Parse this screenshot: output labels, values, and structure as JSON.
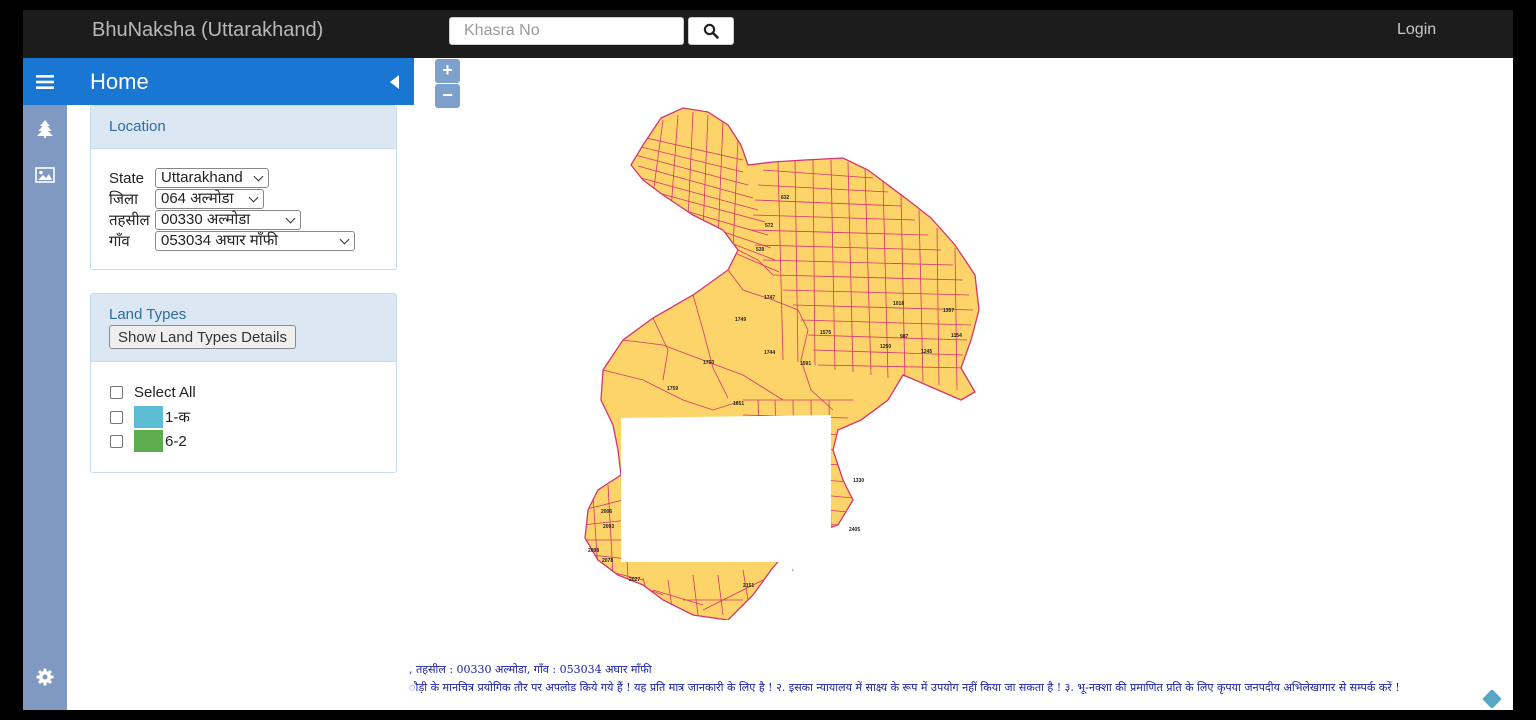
{
  "header": {
    "brand": "BhuNaksha (Uttarakhand)",
    "search_placeholder": "Khasra No",
    "login_label": "Login"
  },
  "panel": {
    "title": "Home"
  },
  "location": {
    "title": "Location",
    "fields": [
      {
        "label": "State",
        "value": "Uttarakhand"
      },
      {
        "label": "जिला",
        "value": "064 अल्मोडा"
      },
      {
        "label": "तहसील",
        "value": "00330 अल्मोडा"
      },
      {
        "label": "गाँव",
        "value": "053034 अघार माँफी"
      }
    ]
  },
  "land_types": {
    "title": "Land Types",
    "details_button": "Show Land Types Details",
    "select_all": "Select All",
    "items": [
      {
        "label": "1-क",
        "color": "#5bbcd4"
      },
      {
        "label": "6-2",
        "color": "#5cad4e"
      }
    ]
  },
  "map": {
    "zoom_in": "+",
    "zoom_out": "−",
    "fill_color": "#fdd46a",
    "boundary_color": "#d7336e",
    "plot_labels": [
      "632",
      "572",
      "539",
      "1747",
      "1749",
      "1753",
      "1759",
      "1744",
      "1575",
      "1591",
      "1250",
      "1245",
      "987",
      "1018",
      "1154",
      "1357",
      "2098",
      "2078",
      "2006",
      "2093",
      "2027",
      "2151",
      "1651",
      "2405",
      "1330"
    ]
  },
  "footer": {
    "line1": ", तहसील : 00330 अल्मोडा, गाँव : 053034 अघार माँफी",
    "line2": "ौड़ी के मानचित्र प्रयोगिक तौर पर अपलोड किये गये हैं ! यह प्रति मात्र जानकारी के लिए है ! २. इसका न्यायालय में साक्ष्य के रूप में उपयोग नहीं किया जा सकता है ! ३. भू-नक्शा की प्रमाणित प्रति के लिए कृपया जनपदीय अभिलेखागार से सम्पर्क करें !"
  }
}
